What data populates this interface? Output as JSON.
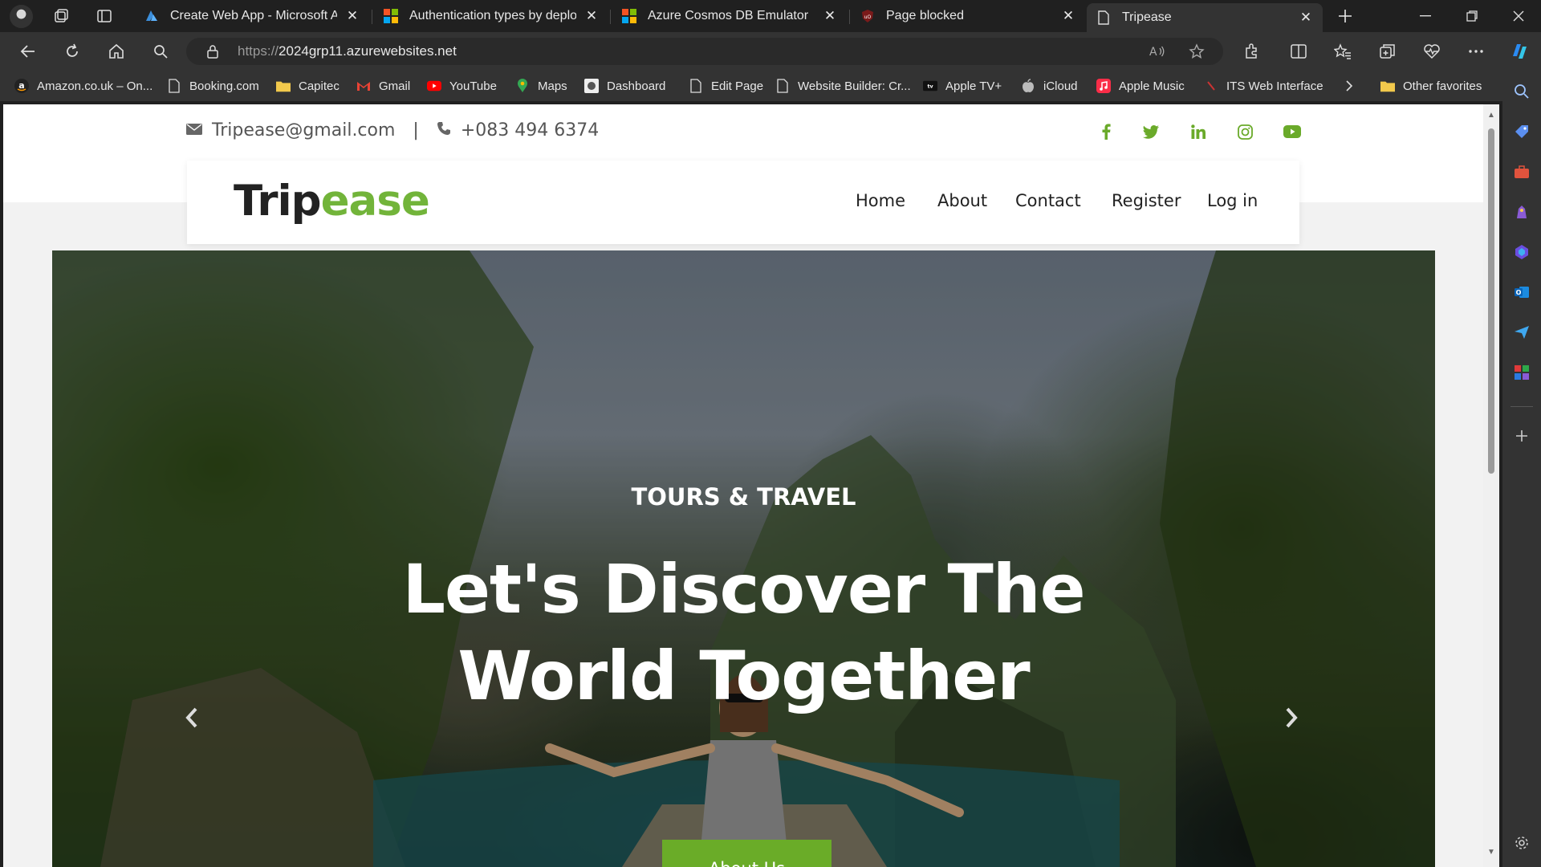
{
  "browser": {
    "tabs": [
      {
        "label": "Create Web App - Microsoft Azure",
        "icon": "azure-icon",
        "active": false
      },
      {
        "label": "Authentication types by deployment",
        "icon": "microsoft-icon",
        "active": false
      },
      {
        "label": "Azure Cosmos DB Emulator",
        "icon": "microsoft-icon",
        "active": false
      },
      {
        "label": "Page blocked",
        "icon": "ublock-icon",
        "active": false
      },
      {
        "label": "Tripease",
        "icon": "page-icon",
        "active": true
      }
    ],
    "address": {
      "prefix": "https://",
      "host": "2024grp11.azurewebsites.net"
    },
    "bookmarks": [
      {
        "label": "Amazon.co.uk – On...",
        "icon": "amazon-icon"
      },
      {
        "label": "Booking.com",
        "icon": "page-icon"
      },
      {
        "label": "Capitec",
        "icon": "folder-icon"
      },
      {
        "label": "Gmail",
        "icon": "gmail-icon"
      },
      {
        "label": "YouTube",
        "icon": "youtube-icon"
      },
      {
        "label": "Maps",
        "icon": "maps-icon"
      },
      {
        "label": "Dashboard",
        "icon": "dashboard-icon"
      },
      {
        "label": "Edit Page",
        "icon": "page-icon"
      },
      {
        "label": "Website Builder: Cr...",
        "icon": "page-icon"
      },
      {
        "label": "Apple TV+",
        "icon": "appletv-icon"
      },
      {
        "label": "iCloud",
        "icon": "apple-icon"
      },
      {
        "label": "Apple Music",
        "icon": "apple-music-icon"
      },
      {
        "label": "ITS Web Interface",
        "icon": "its-icon"
      }
    ],
    "other_favorites": "Other favorites",
    "colors": {
      "chrome_dark": "#202020",
      "toolbar": "#333333"
    }
  },
  "site": {
    "email": "Tripease@gmail.com",
    "divider": "|",
    "phone": "+083 494 6374",
    "social": [
      "facebook-icon",
      "twitter-icon",
      "linkedin-icon",
      "instagram-icon",
      "youtube-icon"
    ],
    "logo": {
      "part1": "Trip",
      "part2": "ease"
    },
    "nav": [
      "Home",
      "About",
      "Contact",
      "Register",
      "Log in"
    ],
    "hero": {
      "kicker": "TOURS & TRAVEL",
      "headline_line1": "Let's Discover The",
      "headline_line2": "World Together",
      "cta": "About Us"
    },
    "colors": {
      "brand_green": "#6aac28",
      "text_dark": "#222222"
    }
  }
}
